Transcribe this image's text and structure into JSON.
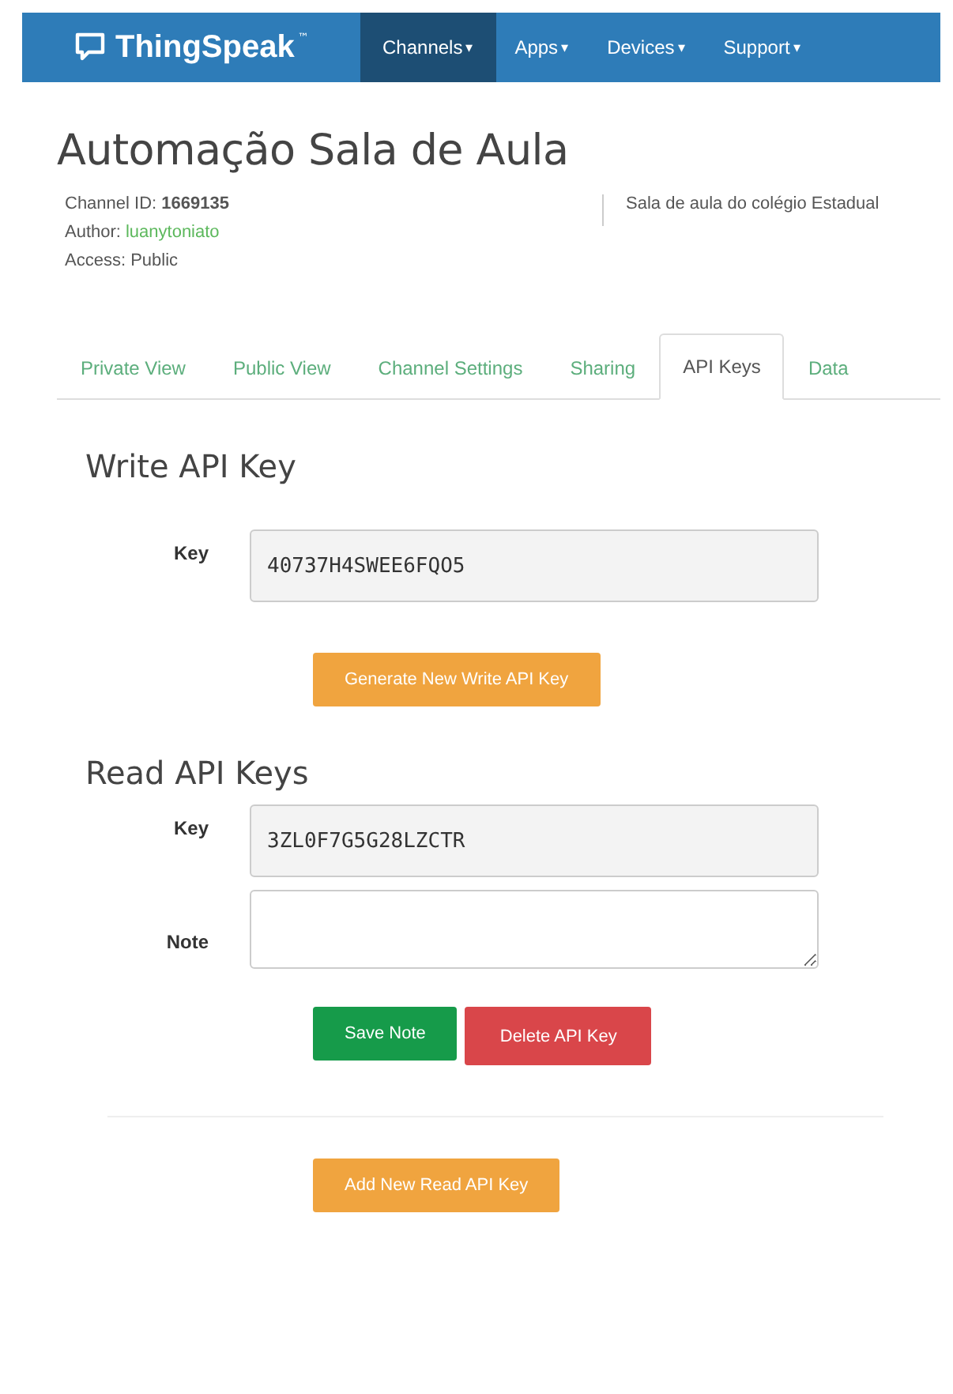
{
  "navbar": {
    "brand": "ThingSpeak",
    "trademark": "™",
    "items": [
      {
        "label": "Channels",
        "caret": "▾",
        "selected": true
      },
      {
        "label": "Apps",
        "caret": "▾",
        "selected": false
      },
      {
        "label": "Devices",
        "caret": "▾",
        "selected": false
      },
      {
        "label": "Support",
        "caret": "▾",
        "selected": false
      }
    ]
  },
  "channel": {
    "title": "Automação Sala de Aula",
    "id_label": "Channel ID:",
    "id": "1669135",
    "author_label": "Author:",
    "author": "luanytoniato",
    "access": "Access: Public",
    "description": "Sala de aula do colégio Estadual"
  },
  "tabs": [
    {
      "label": "Private View",
      "selected": false
    },
    {
      "label": "Public View",
      "selected": false
    },
    {
      "label": "Channel Settings",
      "selected": false
    },
    {
      "label": "Sharing",
      "selected": false
    },
    {
      "label": "API Keys",
      "selected": true
    },
    {
      "label": "Data",
      "selected": false
    }
  ],
  "write_key": {
    "heading": "Write API Key",
    "key_label": "Key",
    "key": "40737H4SWEE6FQO5",
    "button": "Generate New Write API Key"
  },
  "read_keys": {
    "heading": "Read API Keys",
    "key_label": "Key",
    "key": "3ZL0F7G5G28LZCTR",
    "note_label": "Note",
    "save_button": "Save Note",
    "delete_button": "Delete API Key",
    "add_button": "Add New Read API Key"
  }
}
